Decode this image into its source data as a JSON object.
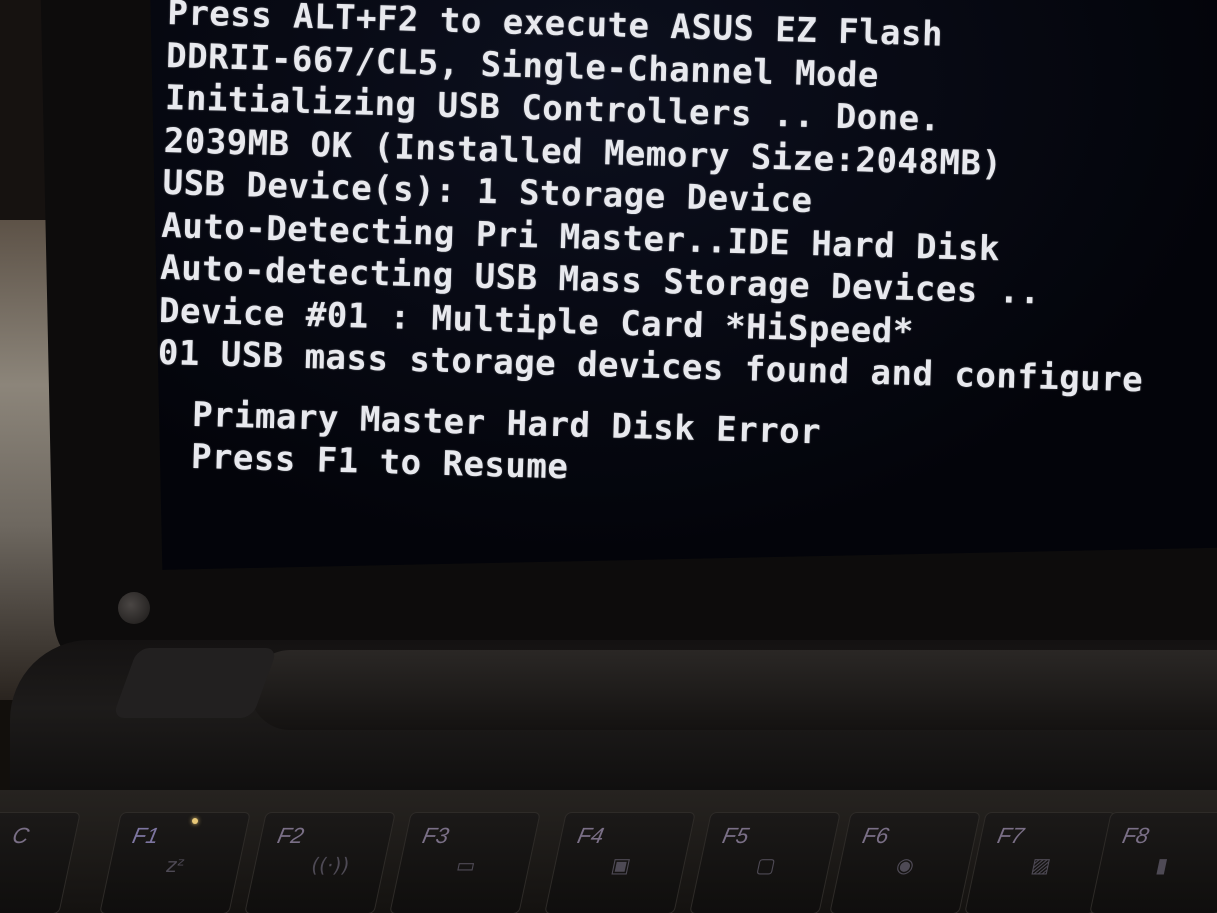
{
  "bios": {
    "lines": [
      "Press ALT+F2 to execute ASUS EZ Flash",
      "DDRII-667/CL5, Single-Channel Mode",
      "Initializing USB Controllers .. Done.",
      "2039MB OK (Installed Memory Size:2048MB)",
      "USB Device(s): 1 Storage Device",
      "Auto-Detecting Pri Master..IDE Hard Disk",
      "Auto-detecting USB Mass Storage Devices ..",
      "Device #01 : Multiple Card *HiSpeed*",
      "01 USB mass storage devices found and configure"
    ],
    "error": "Primary Master Hard Disk Error",
    "prompt": "Press F1 to Resume"
  },
  "keyboard": {
    "keys": [
      {
        "label": "C",
        "icon": "esc-key"
      },
      {
        "label": "F1",
        "icon": "sleep-icon",
        "glyph": "zᶻ"
      },
      {
        "label": "F2",
        "icon": "wireless-icon",
        "glyph": "((·))"
      },
      {
        "label": "F3",
        "icon": "email-icon",
        "glyph": "▭"
      },
      {
        "label": "F4",
        "icon": "brightness-icon",
        "glyph": "▣"
      },
      {
        "label": "F5",
        "icon": "display-icon",
        "glyph": "▢"
      },
      {
        "label": "F6",
        "icon": "camera-icon",
        "glyph": "◉"
      },
      {
        "label": "F7",
        "icon": "backlight-icon",
        "glyph": "▨"
      },
      {
        "label": "F8",
        "icon": "volume-icon",
        "glyph": "▮"
      }
    ]
  },
  "colors": {
    "screen_bg": "#03040a",
    "text": "#e8e9ee",
    "bezel": "#0d0c0c"
  }
}
